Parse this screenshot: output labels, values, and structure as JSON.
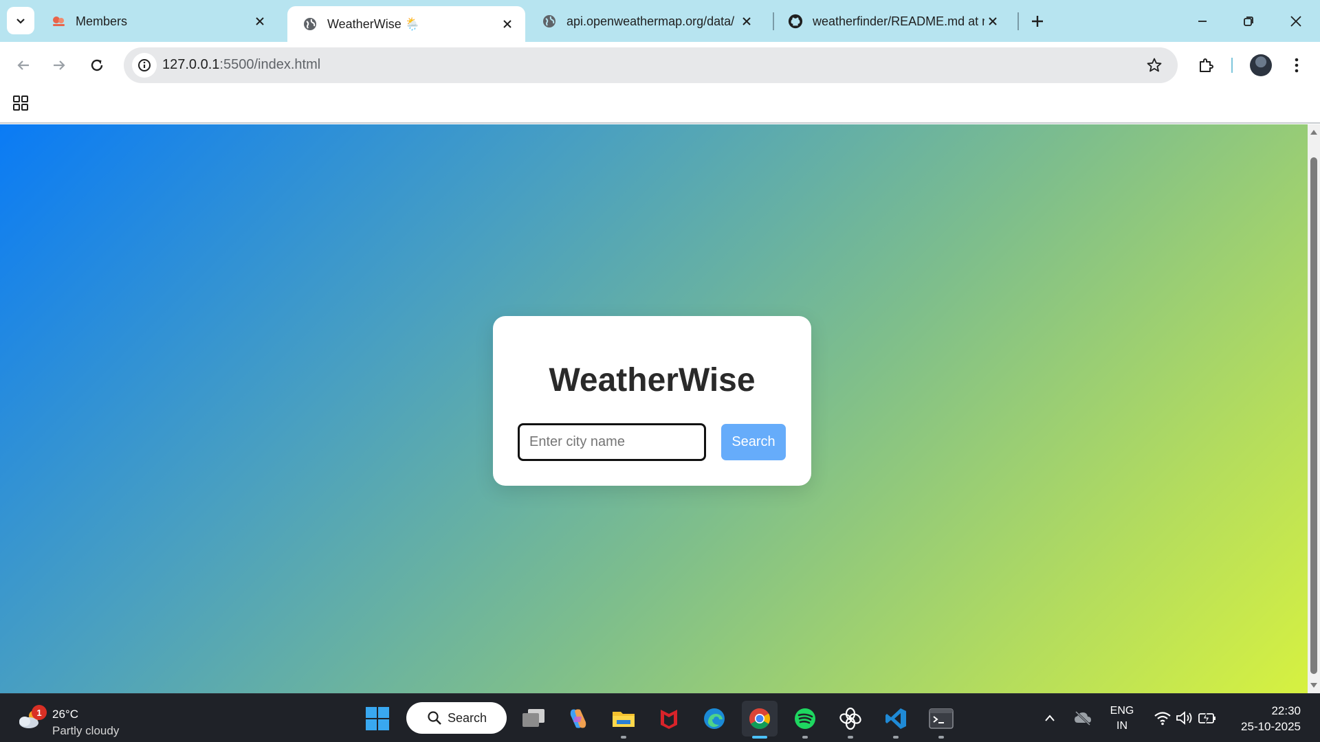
{
  "browser": {
    "tabs": [
      {
        "title": "Members",
        "icon": "members-favicon",
        "active": false
      },
      {
        "title": "WeatherWise 🌦️",
        "icon": "globe-icon",
        "active": true
      },
      {
        "title": "api.openweathermap.org/data/",
        "icon": "globe-icon",
        "active": false
      },
      {
        "title": "weatherfinder/README.md at m",
        "icon": "github-icon",
        "active": false
      }
    ],
    "address": {
      "host": "127.0.0.1",
      "path": ":5500/index.html"
    }
  },
  "page": {
    "title": "WeatherWise",
    "city_input": {
      "placeholder": "Enter city name",
      "value": ""
    },
    "search_label": "Search",
    "gradient": {
      "start": "#0a7bf5",
      "end": "#d8f23f"
    },
    "search_button_color": "#66acfa"
  },
  "taskbar": {
    "weather": {
      "badge": "1",
      "temp": "26°C",
      "condition": "Partly cloudy"
    },
    "search_label": "Search",
    "apps": [
      "start-icon",
      "task-view-icon",
      "copilot-icon",
      "file-explorer-icon",
      "mcafee-icon",
      "edge-icon",
      "chrome-icon",
      "spotify-icon",
      "chatgpt-icon",
      "vscode-icon",
      "terminal-icon"
    ],
    "lang": {
      "line1": "ENG",
      "line2": "IN"
    },
    "clock": {
      "time": "22:30",
      "date": "25-10-2025"
    }
  }
}
